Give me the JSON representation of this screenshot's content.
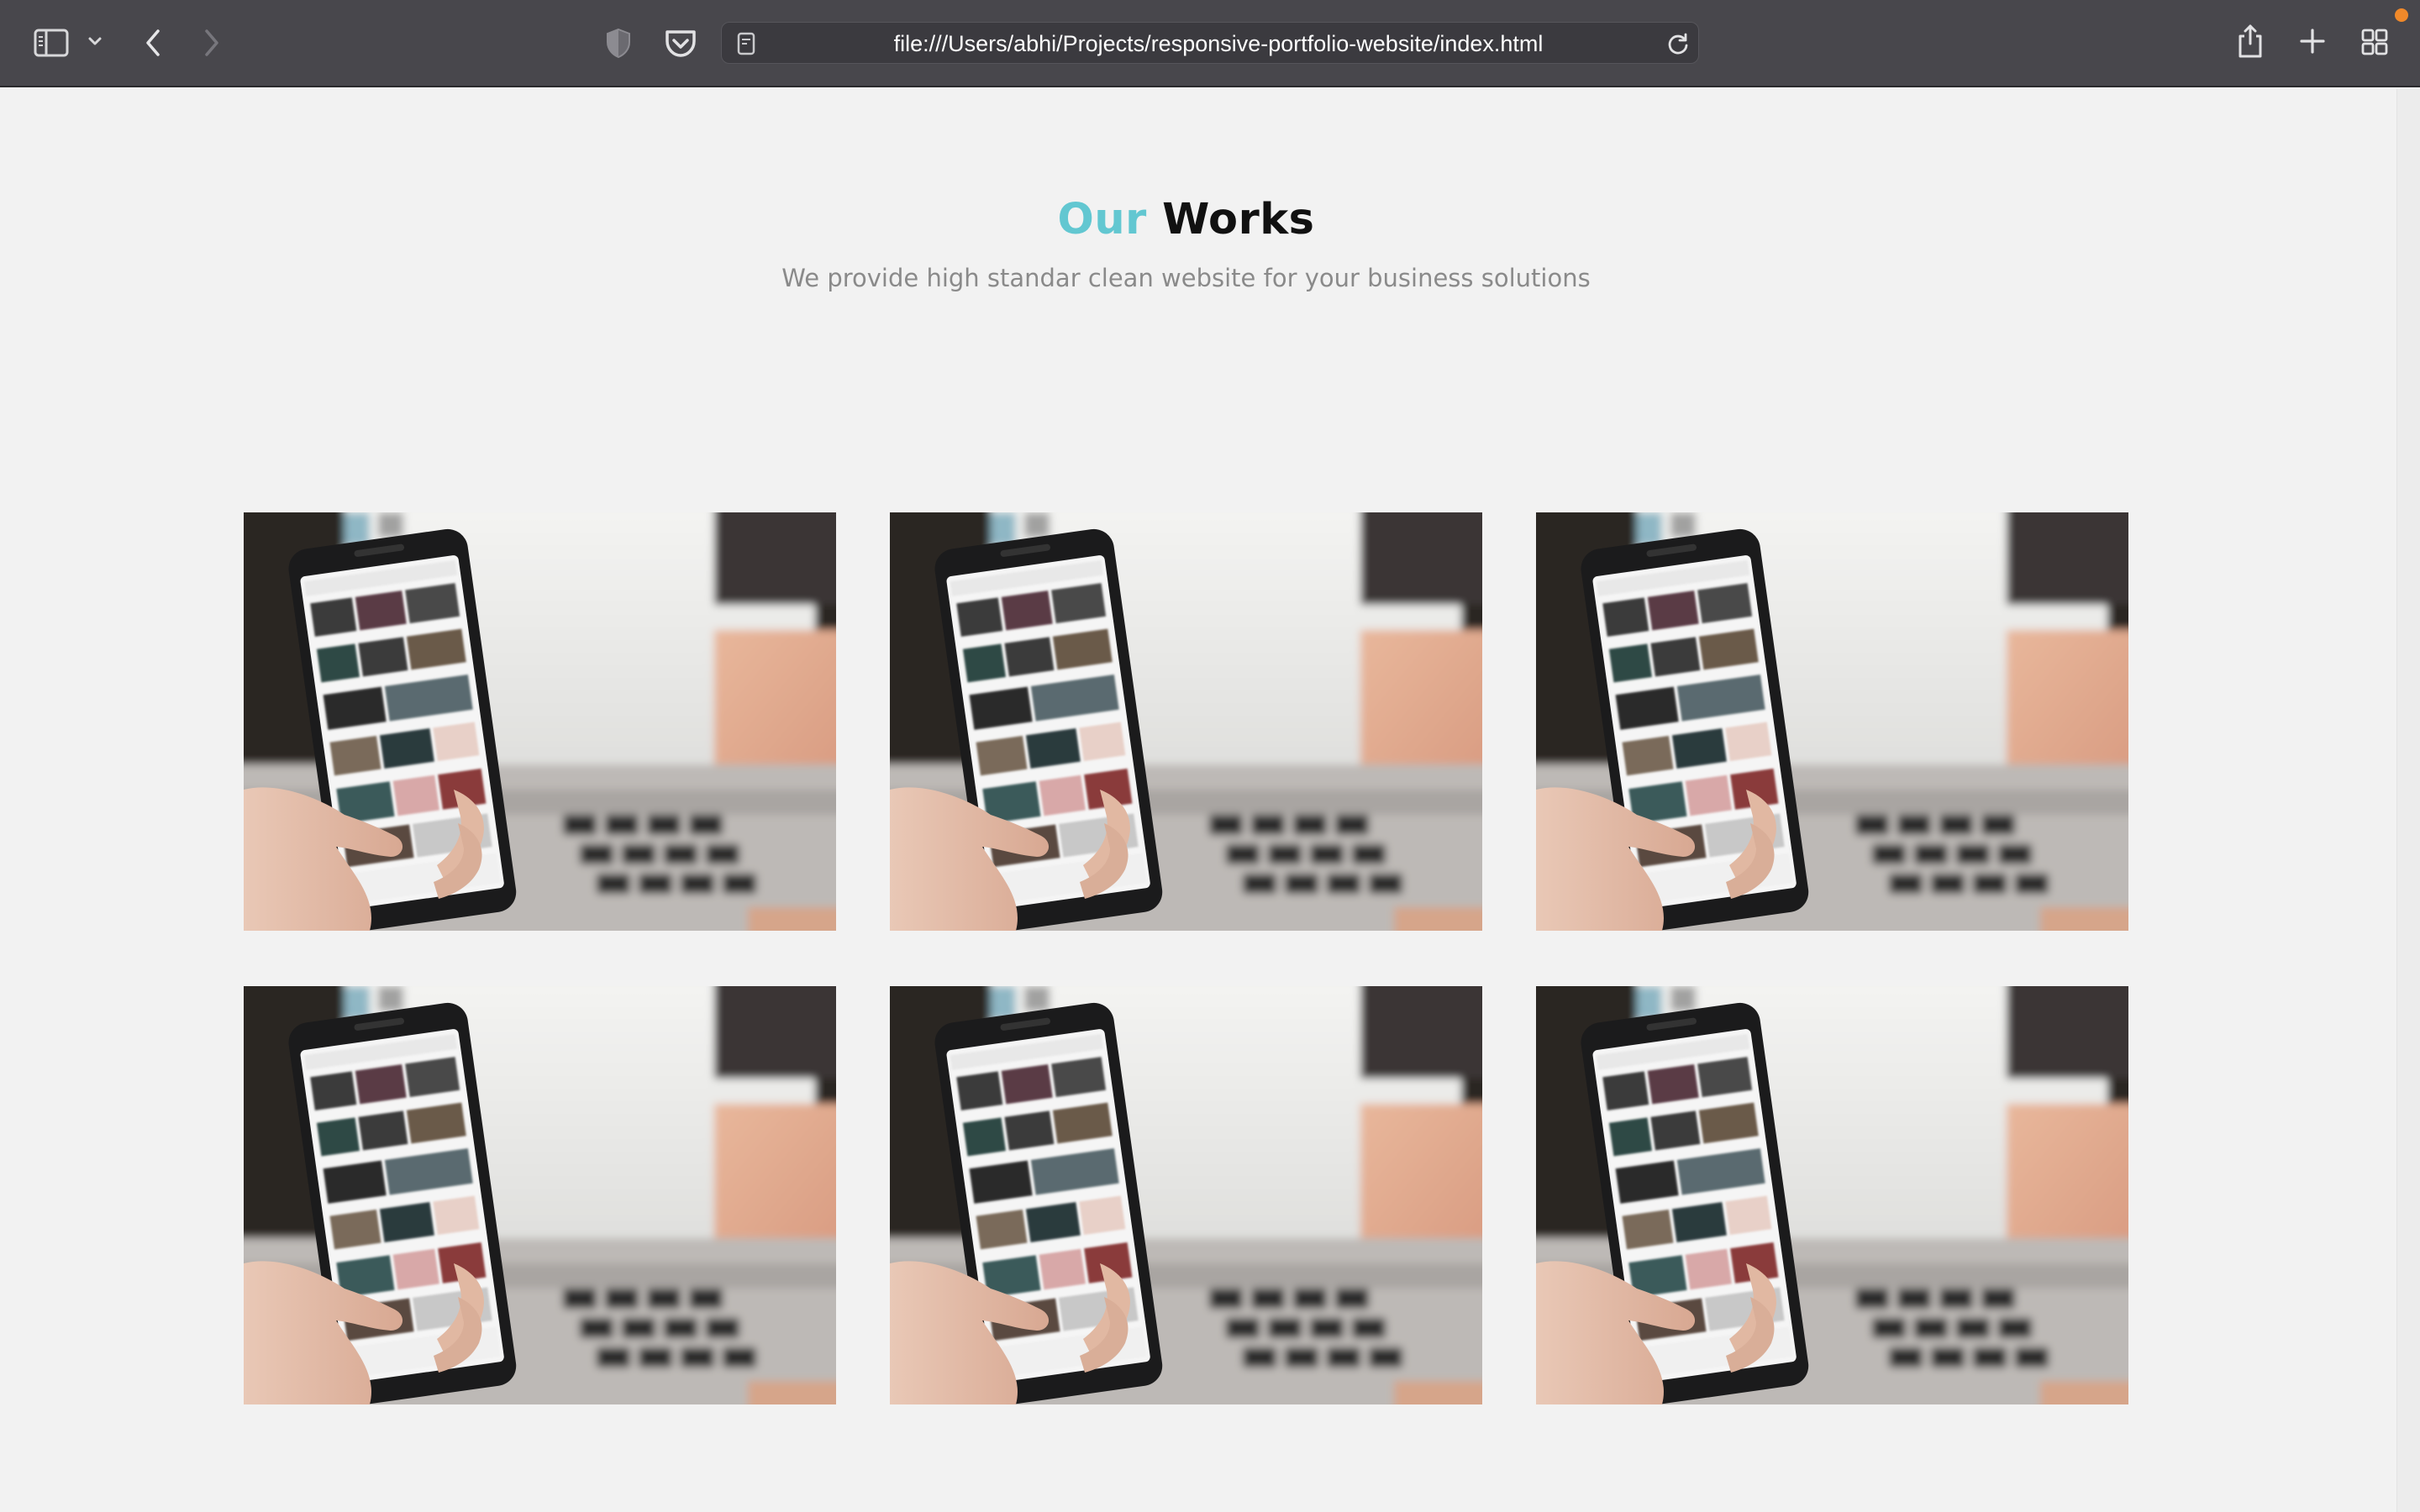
{
  "browser": {
    "url": "file:///Users/abhi/Projects/responsive-portfolio-website/index.html",
    "icons": {
      "sidebar": "sidebar-icon",
      "sidebar_menu": "chevron-down-icon",
      "back": "back-arrow-icon",
      "forward": "forward-arrow-icon",
      "privacy": "shield-icon",
      "pocket": "pocket-icon",
      "page": "page-icon",
      "reload": "reload-icon",
      "share": "share-icon",
      "new_tab": "plus-icon",
      "tab_overview": "grid-icon"
    }
  },
  "section": {
    "title_accent": "Our",
    "title_rest": "Works",
    "subtitle": "We provide high standar clean website for your business solutions"
  },
  "works": [
    {
      "image": "phone-in-hand-photo"
    },
    {
      "image": "phone-in-hand-photo"
    },
    {
      "image": "phone-in-hand-photo"
    },
    {
      "image": "phone-in-hand-photo"
    },
    {
      "image": "phone-in-hand-photo"
    },
    {
      "image": "phone-in-hand-photo"
    }
  ],
  "colors": {
    "accent": "#62c7d1",
    "page_background": "#f2f2f2",
    "toolbar_background": "#48474c",
    "subtitle_text": "#8a8a8a"
  }
}
